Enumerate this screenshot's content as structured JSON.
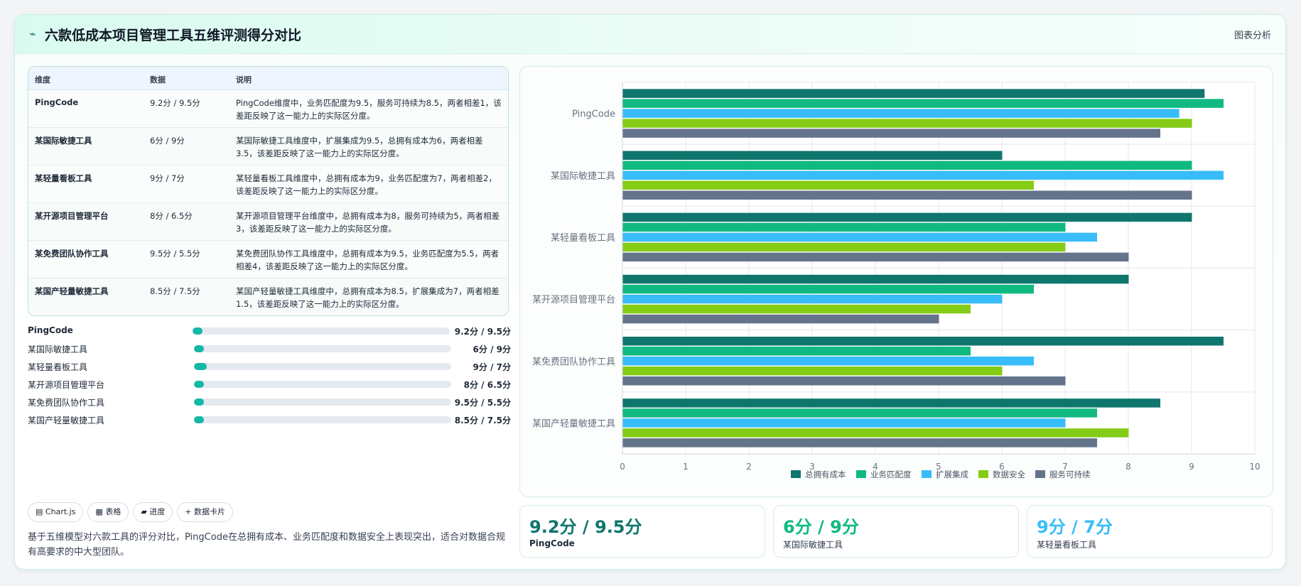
{
  "header": {
    "icon": "chart-trend-icon",
    "title": "六款低成本项目管理工具五维评测得分对比",
    "tag": "图表分析"
  },
  "table": {
    "headers": [
      "维度",
      "数据",
      "说明"
    ],
    "rows": [
      {
        "name": "PingCode",
        "value": "9.2分 / 9.5分",
        "desc": "PingCode维度中，业务匹配度为9.5，服务可持续为8.5，两者相差1，该差距反映了这一能力上的实际区分度。"
      },
      {
        "name": "某国际敏捷工具",
        "value": "6分 / 9分",
        "desc": "某国际敏捷工具维度中，扩展集成为9.5，总拥有成本为6，两者相差3.5，该差距反映了这一能力上的实际区分度。"
      },
      {
        "name": "某轻量看板工具",
        "value": "9分 / 7分",
        "desc": "某轻量看板工具维度中，总拥有成本为9，业务匹配度为7，两者相差2，该差距反映了这一能力上的实际区分度。"
      },
      {
        "name": "某开源项目管理平台",
        "value": "8分 / 6.5分",
        "desc": "某开源项目管理平台维度中，总拥有成本为8，服务可持续为5，两者相差3，该差距反映了这一能力上的实际区分度。"
      },
      {
        "name": "某免费团队协作工具",
        "value": "9.5分 / 5.5分",
        "desc": "某免费团队协作工具维度中，总拥有成本为9.5，业务匹配度为5.5，两者相差4，该差距反映了这一能力上的实际区分度。"
      },
      {
        "name": "某国产轻量敏捷工具",
        "value": "8.5分 / 7.5分",
        "desc": "某国产轻量敏捷工具维度中，总拥有成本为8.5，扩展集成为7，两者相差1.5，该差距反映了这一能力上的实际区分度。"
      }
    ]
  },
  "progress": [
    {
      "name": "PingCode",
      "value": "9.2分 / 9.5分",
      "fraction": 0.04
    },
    {
      "name": "某国际敏捷工具",
      "value": "6分 / 9分",
      "fraction": 0.04
    },
    {
      "name": "某轻量看板工具",
      "value": "9分 / 7分",
      "fraction": 0.05
    },
    {
      "name": "某开源项目管理平台",
      "value": "8分 / 6.5分",
      "fraction": 0.04
    },
    {
      "name": "某免费团队协作工具",
      "value": "9.5分 / 5.5分",
      "fraction": 0.04
    },
    {
      "name": "某国产轻量敏捷工具",
      "value": "8.5分 / 7.5分",
      "fraction": 0.04
    }
  ],
  "chips": [
    {
      "icon": "chart-icon",
      "glyph": "▤",
      "label": "Chart.js"
    },
    {
      "icon": "table-icon",
      "glyph": "▦",
      "label": "表格"
    },
    {
      "icon": "progress-icon",
      "glyph": "▰",
      "label": "进度"
    },
    {
      "icon": "plus-icon",
      "glyph": "+",
      "label": "数据卡片"
    }
  ],
  "summary": "基于五维模型对六款工具的评分对比，PingCode在总拥有成本、业务匹配度和数据安全上表现突出，适合对数据合规有高要求的中大型团队。",
  "kpis": [
    {
      "value": "9.2分 / 9.5分",
      "label": "PingCode",
      "color": "#0f766e"
    },
    {
      "value": "6分 / 9分",
      "label": "某国际敏捷工具",
      "color": "#10b981"
    },
    {
      "value": "9分 / 7分",
      "label": "某轻量看板工具",
      "color": "#38bdf8"
    }
  ],
  "chart_data": {
    "type": "bar",
    "orientation": "horizontal",
    "categories": [
      "PingCode",
      "某国际敏捷工具",
      "某轻量看板工具",
      "某开源项目管理平台",
      "某免费团队协作工具",
      "某国产轻量敏捷工具"
    ],
    "series": [
      {
        "name": "总拥有成本",
        "color": "#0f766e",
        "values": [
          9.2,
          6,
          9,
          8,
          9.5,
          8.5
        ]
      },
      {
        "name": "业务匹配度",
        "color": "#10b981",
        "values": [
          9.5,
          9,
          7,
          6.5,
          5.5,
          7.5
        ]
      },
      {
        "name": "扩展集成",
        "color": "#38bdf8",
        "values": [
          8.8,
          9.5,
          7.5,
          6,
          6.5,
          7
        ]
      },
      {
        "name": "数据安全",
        "color": "#84cc16",
        "values": [
          9,
          6.5,
          7,
          5.5,
          6,
          8
        ]
      },
      {
        "name": "服务可持续",
        "color": "#64748b",
        "values": [
          8.5,
          9,
          8,
          5,
          7,
          7.5
        ]
      }
    ],
    "xlim": [
      0,
      10
    ],
    "xticks": [
      "0",
      "1",
      "2",
      "3",
      "4",
      "5",
      "6",
      "7",
      "8",
      "9",
      "10"
    ],
    "grid": true,
    "legend_position": "bottom"
  }
}
